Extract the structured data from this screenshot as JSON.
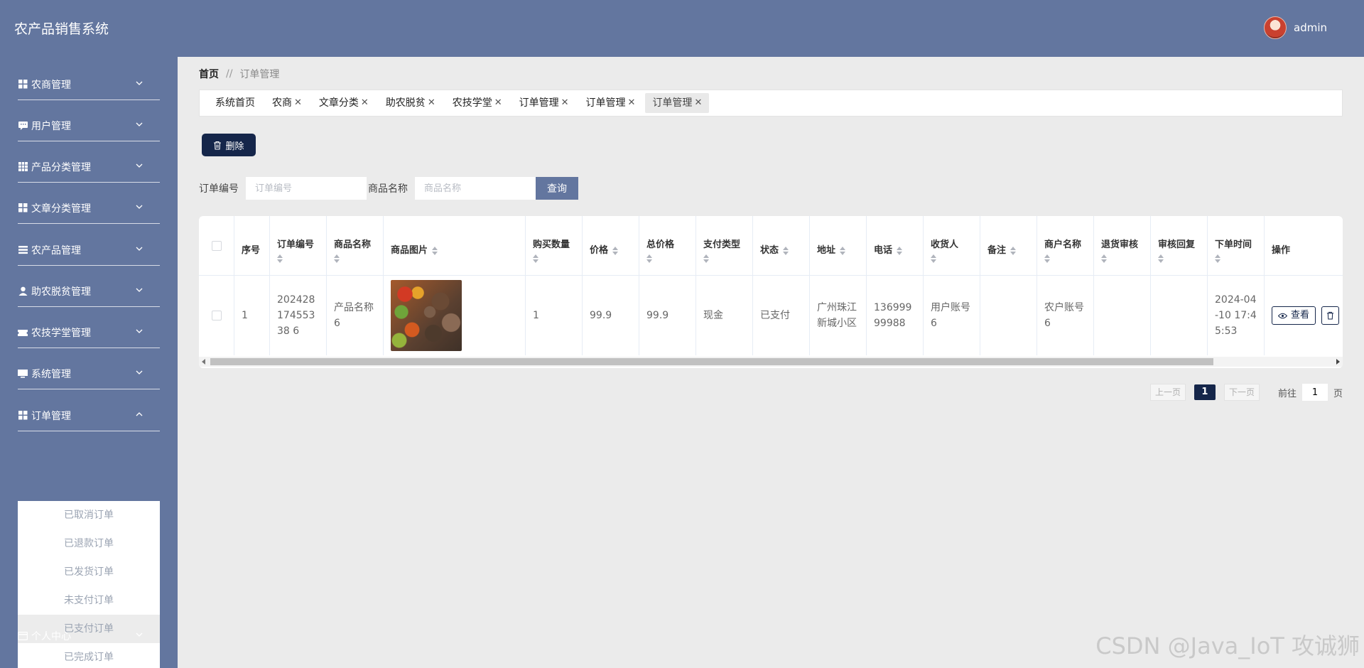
{
  "header": {
    "app_title": "农产品销售系统",
    "username": "admin"
  },
  "sidebar": {
    "items": [
      {
        "label": "农商管理",
        "icon": "grid-icon"
      },
      {
        "label": "用户管理",
        "icon": "chat-icon"
      },
      {
        "label": "产品分类管理",
        "icon": "table-icon"
      },
      {
        "label": "文章分类管理",
        "icon": "grid-icon"
      },
      {
        "label": "农产品管理",
        "icon": "list-icon"
      },
      {
        "label": "助农脱贫管理",
        "icon": "user-icon"
      },
      {
        "label": "农技学堂管理",
        "icon": "ticket-icon"
      },
      {
        "label": "系统管理",
        "icon": "monitor-icon"
      },
      {
        "label": "订单管理",
        "icon": "grid-icon"
      },
      {
        "label": "个人中心",
        "icon": "card-icon"
      }
    ],
    "submenu": [
      "已取消订单",
      "已退款订单",
      "已发货订单",
      "未支付订单",
      "已支付订单",
      "已完成订单"
    ],
    "submenu_active_index": 4
  },
  "breadcrumb": {
    "home": "首页",
    "sep": "//",
    "current": "订单管理"
  },
  "tabs": [
    {
      "label": "系统首页",
      "closable": false
    },
    {
      "label": "农商",
      "closable": true
    },
    {
      "label": "文章分类",
      "closable": true
    },
    {
      "label": "助农脱贫",
      "closable": true
    },
    {
      "label": "农技学堂",
      "closable": true
    },
    {
      "label": "订单管理",
      "closable": true
    },
    {
      "label": "订单管理",
      "closable": true
    },
    {
      "label": "订单管理",
      "closable": true
    }
  ],
  "toolbar": {
    "delete_label": "删除"
  },
  "search": {
    "order_no_label": "订单编号",
    "order_no_placeholder": "订单编号",
    "product_name_label": "商品名称",
    "product_name_placeholder": "商品名称",
    "query_label": "查询"
  },
  "table": {
    "headers": {
      "index": "序号",
      "order_no": "订单编号",
      "product_name": "商品名称",
      "product_image": "商品图片",
      "quantity": "购买数量",
      "price": "价格",
      "total": "总价格",
      "pay_type": "支付类型",
      "status": "状态",
      "address": "地址",
      "phone": "电话",
      "receiver": "收货人",
      "remark": "备注",
      "merchant": "商户名称",
      "refund_review": "退货审核",
      "review_reply": "审核回复",
      "order_time": "下单时间",
      "actions": "操作"
    },
    "rows": [
      {
        "index": "1",
        "order_no": "20242817455338 6",
        "product_name": "产品名称6",
        "quantity": "1",
        "price": "99.9",
        "total": "99.9",
        "pay_type": "现金",
        "status": "已支付",
        "address": "广州珠江新城小区",
        "phone": "13699999988",
        "receiver": "用户账号6",
        "remark": "",
        "merchant": "农户账号6",
        "refund_review": "",
        "review_reply": "",
        "order_time": "2024-04-10 17:45:53",
        "view_label": "查看"
      }
    ]
  },
  "pagination": {
    "prev": "上一页",
    "current_page": "1",
    "next": "下一页",
    "goto_prefix": "前往",
    "goto_value": "1",
    "goto_suffix": "页"
  },
  "watermark": "CSDN @Java_IoT 攻诚狮",
  "colors": {
    "header_bg": "#63769f",
    "primary_dark": "#15264a",
    "page_bg": "#ebebeb"
  }
}
